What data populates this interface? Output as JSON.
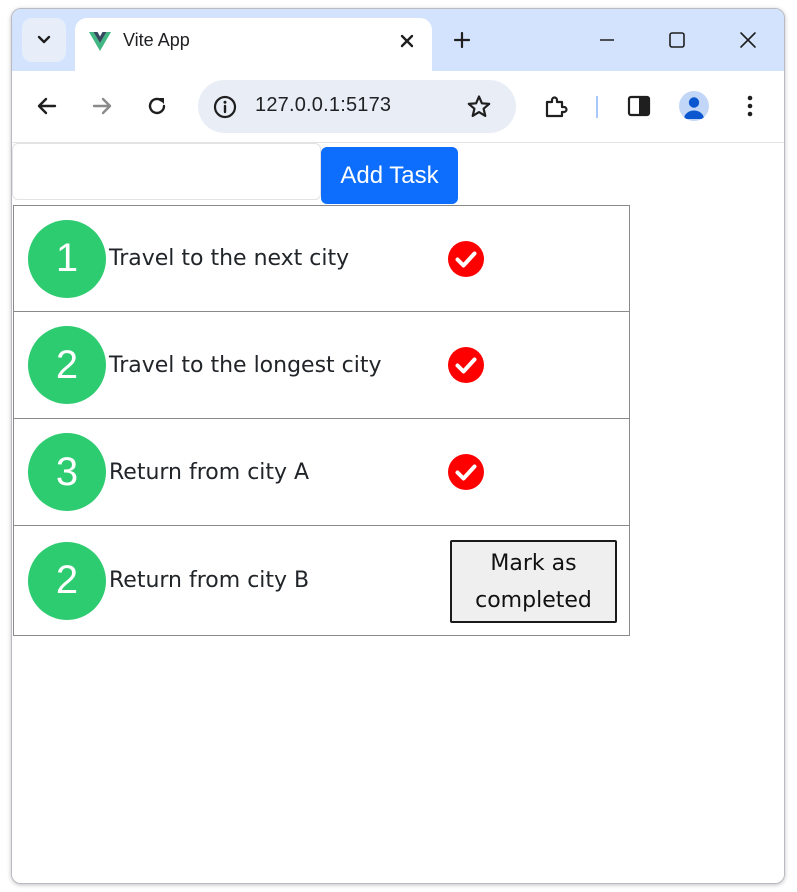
{
  "browser": {
    "tab_title": "Vite App",
    "url": "127.0.0.1:5173",
    "icons": [
      "tab-search-icon",
      "vue-logo-icon",
      "close-icon",
      "plus-icon",
      "minimize-icon",
      "maximize-icon",
      "window-close-icon",
      "back-icon",
      "forward-icon",
      "reload-icon",
      "info-icon",
      "star-icon",
      "extensions-icon",
      "sidepanel-icon",
      "profile-icon",
      "menu-icon"
    ]
  },
  "app": {
    "input_value": "",
    "add_button_label": "Add Task",
    "tasks": [
      {
        "number": "1",
        "text": "Travel to the next city",
        "completed": true
      },
      {
        "number": "2",
        "text": "Travel to the longest city",
        "completed": true
      },
      {
        "number": "3",
        "text": "Return from city A",
        "completed": true
      },
      {
        "number": "2",
        "text": "Return from city B",
        "completed": false,
        "action_label": "Mark as completed"
      }
    ]
  },
  "colors": {
    "accent": "#0d6efd",
    "badge": "#2ecc71",
    "check": "#ff0000",
    "tabstrip": "#d3e3fd"
  }
}
